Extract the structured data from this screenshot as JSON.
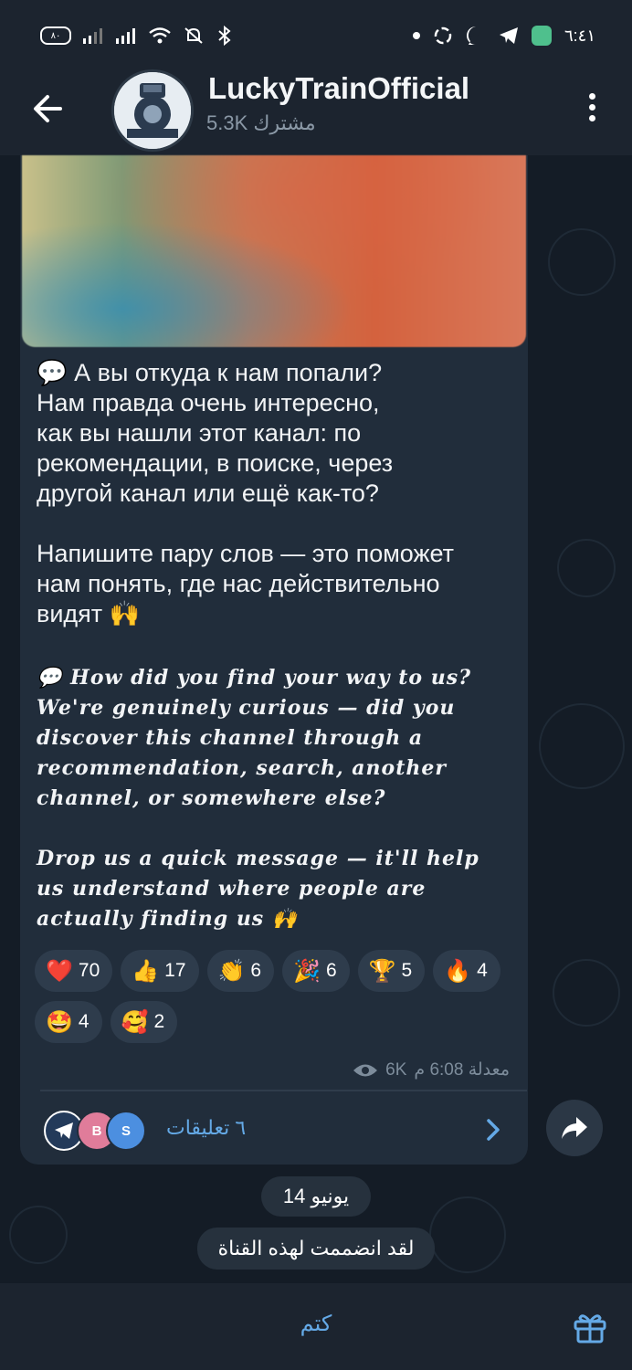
{
  "status_bar": {
    "time": "٦:٤١",
    "battery": "٨٠",
    "icons": [
      "battery-icon",
      "signal-icon",
      "signal-icon",
      "wifi-icon",
      "mute-icon",
      "bluetooth-icon",
      "dot-icon",
      "app-icon",
      "messenger-icon",
      "telegram-icon",
      "app-green-icon"
    ]
  },
  "header": {
    "title": "LuckyTrainOfficial",
    "subscribers": "5.3K مشترك",
    "back_icon": "back-arrow-icon",
    "menu_icon": "more-vert-icon"
  },
  "post": {
    "text_ru": "💬 А вы откуда к нам попали?\nНам правда очень интересно,\nкак вы нашли этот канал: по\nрекомендации, в поиске, через\nдругой канал или ещё как-то?\n\nНапишите пару слов — это поможет\nнам понять, где нас действительно\nвидят 🙌",
    "text_en": "💬 How did you find your way to us?\nWe're genuinely curious — did you\ndiscover this channel through a\nrecommendation, search, another\nchannel, or somewhere else?\n\nDrop us a quick message — it'll help\nus understand where people are\nactually finding us 🙌",
    "reactions": [
      {
        "emoji": "❤️",
        "count": "70"
      },
      {
        "emoji": "👍",
        "count": "17"
      },
      {
        "emoji": "👏",
        "count": "6"
      },
      {
        "emoji": "🎉",
        "count": "6"
      },
      {
        "emoji": "🏆",
        "count": "5"
      },
      {
        "emoji": "🔥",
        "count": "4"
      },
      {
        "emoji": "🤩",
        "count": "4"
      },
      {
        "emoji": "🥰",
        "count": "2"
      }
    ],
    "views": "6K",
    "time": "معدلة 6:08 م",
    "comments_label": "٦ تعليقات",
    "comment_avatars": [
      "B",
      "S"
    ]
  },
  "date_divider": "14 يونيو",
  "joined_notice": "لقد انضممت لهذه القناة",
  "bottom": {
    "mute_label": "كتم",
    "gift_icon": "gift-icon"
  },
  "colors": {
    "accent": "#64a9e6",
    "bubble": "#212d3b",
    "header": "#1c242f",
    "background": "#141c26"
  }
}
